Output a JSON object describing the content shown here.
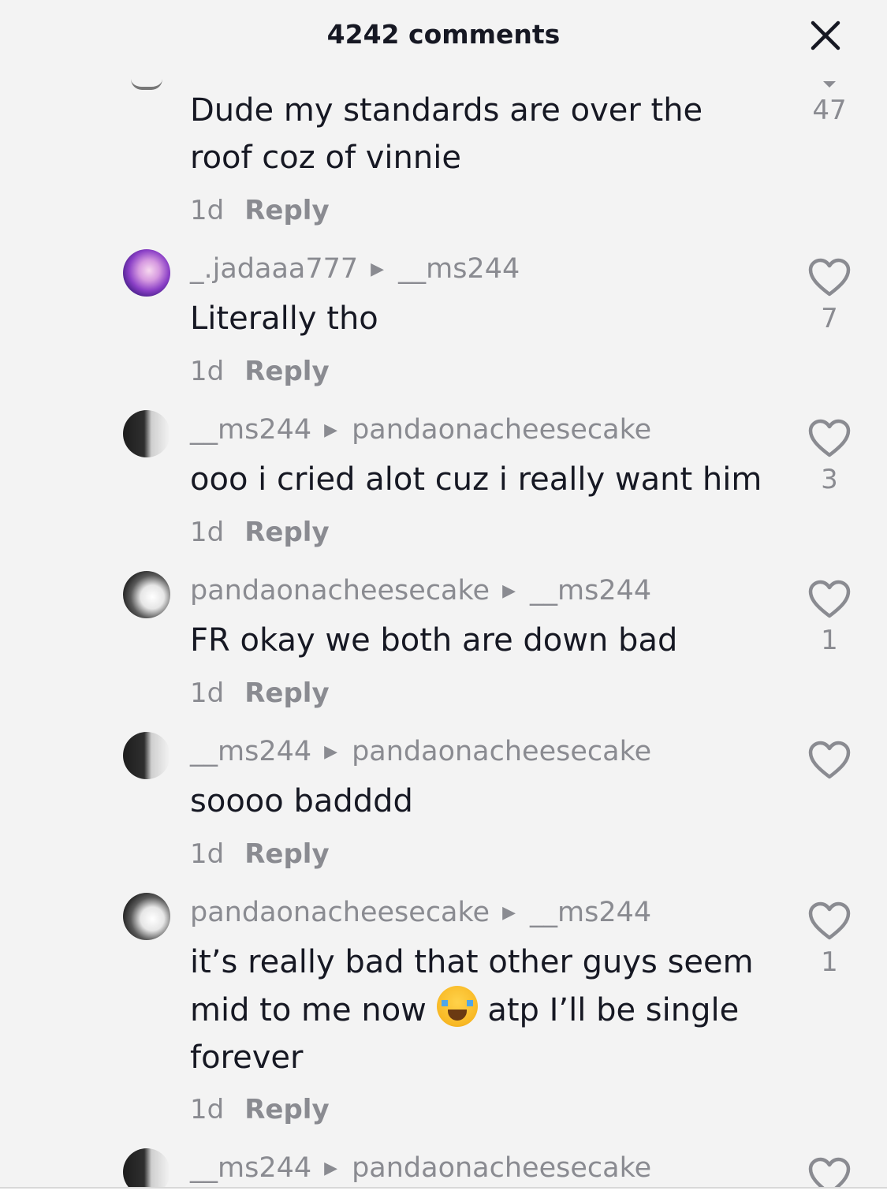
{
  "header": {
    "title": "4242 comments"
  },
  "comments": [
    {
      "text": "Dude my standards are over the roof coz of vinnie",
      "age": "1d",
      "reply": "Reply",
      "likes": "47"
    },
    {
      "user": "_.jadaaa777",
      "to": "__ms244",
      "text": "Literally tho",
      "age": "1d",
      "reply": "Reply",
      "likes": "7"
    },
    {
      "user": "__ms244",
      "to": "pandaonacheesecake",
      "text": "ooo i cried alot cuz i really want him",
      "age": "1d",
      "reply": "Reply",
      "likes": "3"
    },
    {
      "user": "pandaonacheesecake",
      "to": "__ms244",
      "text": "FR okay we both are down bad",
      "age": "1d",
      "reply": "Reply",
      "likes": "1"
    },
    {
      "user": "__ms244",
      "to": "pandaonacheesecake",
      "text": "soooo badddd",
      "age": "1d",
      "reply": "Reply",
      "likes": ""
    },
    {
      "user": "pandaonacheesecake",
      "to": "__ms244",
      "text_part1": "it’s really bad that other guys seem",
      "text_part2": "mid to me now",
      "text_part3": "atp I’ll be single",
      "text_part4": "forever",
      "age": "1d",
      "reply": "Reply",
      "likes": "1"
    },
    {
      "user": "__ms244",
      "to": "pandaonacheesecake"
    }
  ],
  "colors": {
    "background": "#f3f3f3",
    "text": "#161823",
    "muted": "#8a8b91"
  },
  "icons": {
    "close": "close-icon",
    "like": "heart-outline-icon",
    "reply_arrow": "caret-right-icon",
    "emoji": "loudly-crying-face-emoji"
  }
}
